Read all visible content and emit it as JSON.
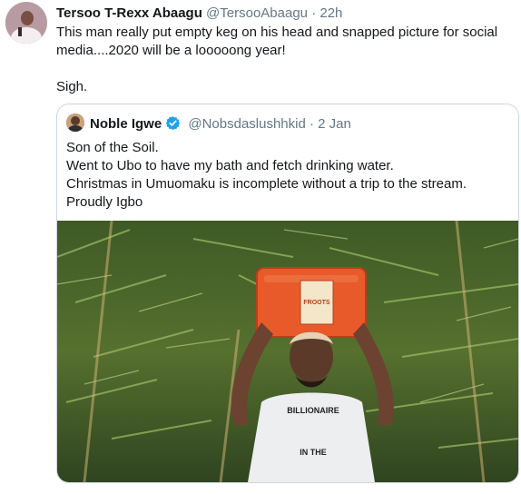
{
  "tweet": {
    "author_name": "Tersoo T-Rexx Abaagu",
    "handle": "@TersooAbaagu",
    "separator": "·",
    "time": "22h",
    "lines": [
      "This man really put empty keg on his head and snapped picture for social",
      "media....2020 will be a looooong year!"
    ],
    "line_after_break": "Sigh."
  },
  "quoted": {
    "author_name": "Noble Igwe",
    "handle": "@Nobsdaslushhkid",
    "separator": "·",
    "time": "2 Jan",
    "verified": true,
    "lines": [
      "Son of the Soil.",
      "Went to Ubo to have my bath and fetch drinking water.",
      "Christmas in Umuomaku is incomplete without a trip to the stream.",
      "Proudly Igbo"
    ],
    "shirt_text_line1": "BILLIONAIRE",
    "shirt_text_line2": "IN THE",
    "keg_label": "FROOTS"
  },
  "icons": {
    "verified": "verified-badge-icon"
  },
  "colors": {
    "text": "#14171a",
    "secondary": "#657786",
    "verified": "#1da1f2",
    "border": "#ccd6dd",
    "keg": "#e85a2a"
  }
}
